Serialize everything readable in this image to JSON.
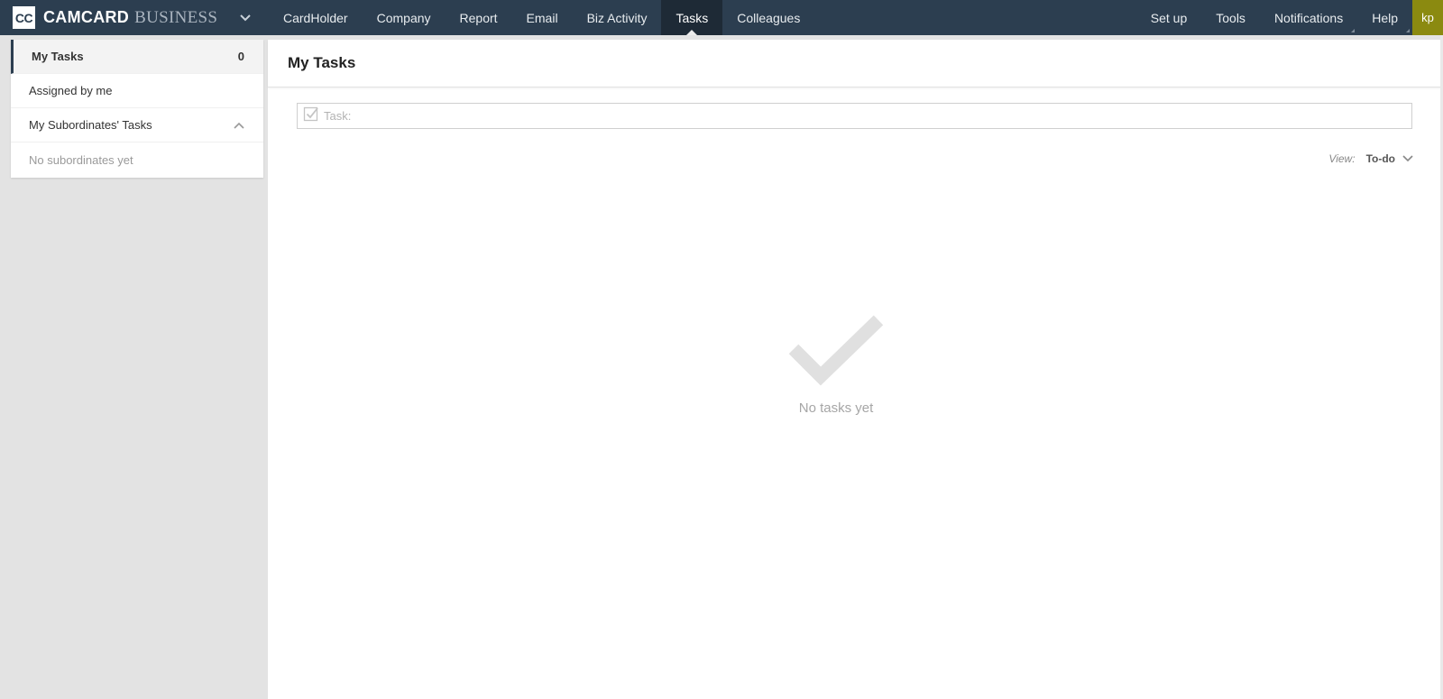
{
  "brand": {
    "logo_text": "CC",
    "name": "CAMCARD",
    "suffix": "BUSINESS"
  },
  "nav": {
    "left": [
      {
        "label": "CardHolder"
      },
      {
        "label": "Company"
      },
      {
        "label": "Report"
      },
      {
        "label": "Email"
      },
      {
        "label": "Biz Activity"
      },
      {
        "label": "Tasks",
        "active": true
      },
      {
        "label": "Colleagues"
      }
    ],
    "right": [
      {
        "label": "Set up"
      },
      {
        "label": "Tools"
      },
      {
        "label": "Notifications"
      },
      {
        "label": "Help"
      }
    ],
    "avatar": "kp"
  },
  "sidebar": {
    "my_tasks": {
      "label": "My Tasks",
      "count": "0"
    },
    "assigned_by_me": {
      "label": "Assigned by me"
    },
    "subordinates": {
      "label": "My Subordinates' Tasks"
    },
    "empty_text": "No subordinates yet"
  },
  "main": {
    "title": "My Tasks",
    "task_input": {
      "placeholder": "Task:",
      "value": ""
    },
    "view": {
      "label": "View:",
      "value": "To-do"
    },
    "empty_text": "No tasks yet"
  },
  "colors": {
    "topbar": "#2c3e50",
    "topbar_active": "#1e2a36",
    "avatar_bg": "#8b8a10",
    "empty_check": "#e0e0e0"
  }
}
